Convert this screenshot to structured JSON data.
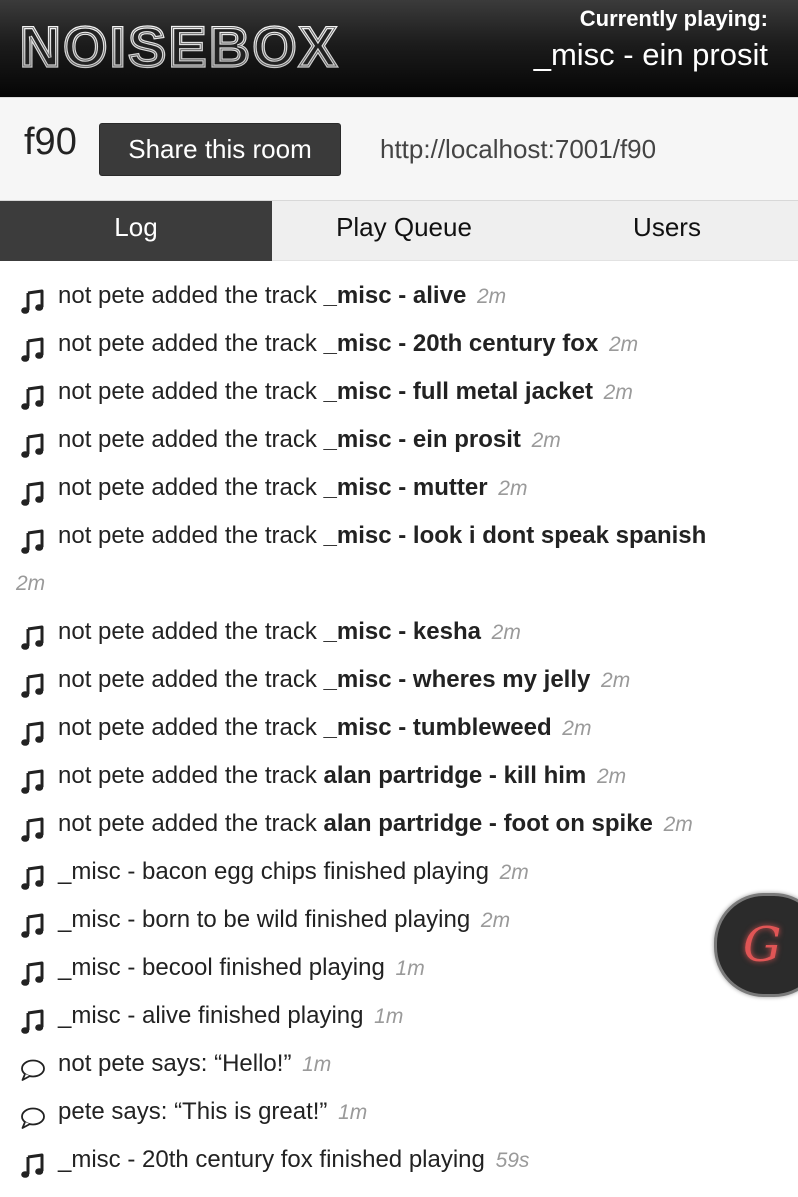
{
  "app": {
    "logo_text": "NOISEBOX"
  },
  "now_playing": {
    "label": "Currently playing:",
    "track": "_misc - ein prosit"
  },
  "room": {
    "name": "f90",
    "share_label": "Share this room",
    "url": "http://localhost:7001/f90"
  },
  "tabs": [
    {
      "label": "Log",
      "active": true
    },
    {
      "label": "Play Queue",
      "active": false
    },
    {
      "label": "Users",
      "active": false
    }
  ],
  "log": [
    {
      "icon": "music-note-icon",
      "text": "not pete added the track ",
      "bold": "_misc - alive",
      "time": "2m"
    },
    {
      "icon": "music-note-icon",
      "text": "not pete added the track ",
      "bold": "_misc - 20th century fox",
      "time": "2m"
    },
    {
      "icon": "music-note-icon",
      "text": "not pete added the track ",
      "bold": "_misc - full metal jacket",
      "time": "2m"
    },
    {
      "icon": "music-note-icon",
      "text": "not pete added the track ",
      "bold": "_misc - ein prosit",
      "time": "2m"
    },
    {
      "icon": "music-note-icon",
      "text": "not pete added the track ",
      "bold": "_misc - mutter",
      "time": "2m"
    },
    {
      "icon": "music-note-icon",
      "text": "not pete added the track ",
      "bold": "_misc - look i dont speak spanish",
      "time": "2m"
    },
    {
      "icon": "music-note-icon",
      "text": "not pete added the track ",
      "bold": "_misc - kesha",
      "time": "2m"
    },
    {
      "icon": "music-note-icon",
      "text": "not pete added the track ",
      "bold": "_misc - wheres my jelly",
      "time": "2m"
    },
    {
      "icon": "music-note-icon",
      "text": "not pete added the track ",
      "bold": "_misc - tumbleweed",
      "time": "2m"
    },
    {
      "icon": "music-note-icon",
      "text": "not pete added the track ",
      "bold": "alan partridge - kill him",
      "time": "2m"
    },
    {
      "icon": "music-note-icon",
      "text": "not pete added the track ",
      "bold": "alan partridge - foot on spike",
      "time": "2m"
    },
    {
      "icon": "music-note-icon",
      "text": "_misc - bacon egg chips finished playing",
      "bold": "",
      "time": "2m"
    },
    {
      "icon": "music-note-icon",
      "text": "_misc - born to be wild finished playing",
      "bold": "",
      "time": "2m"
    },
    {
      "icon": "music-note-icon",
      "text": "_misc - becool finished playing",
      "bold": "",
      "time": "1m"
    },
    {
      "icon": "music-note-icon",
      "text": "_misc - alive finished playing",
      "bold": "",
      "time": "1m"
    },
    {
      "icon": "speech-bubble-icon",
      "text": "not pete says: “Hello!”",
      "bold": "",
      "time": "1m"
    },
    {
      "icon": "speech-bubble-icon",
      "text": "pete says: “This is great!”",
      "bold": "",
      "time": "1m"
    },
    {
      "icon": "music-note-icon",
      "text": "_misc - 20th century fox finished playing",
      "bold": "",
      "time": "59s"
    }
  ],
  "floating_badge": {
    "glyph": "G"
  },
  "colors": {
    "header_bg": "#1c1c1c",
    "active_tab_bg": "#3c3c3c",
    "tab_bg": "#efefef",
    "time_text": "#9a9a9a",
    "badge_glyph": "#e05555"
  }
}
